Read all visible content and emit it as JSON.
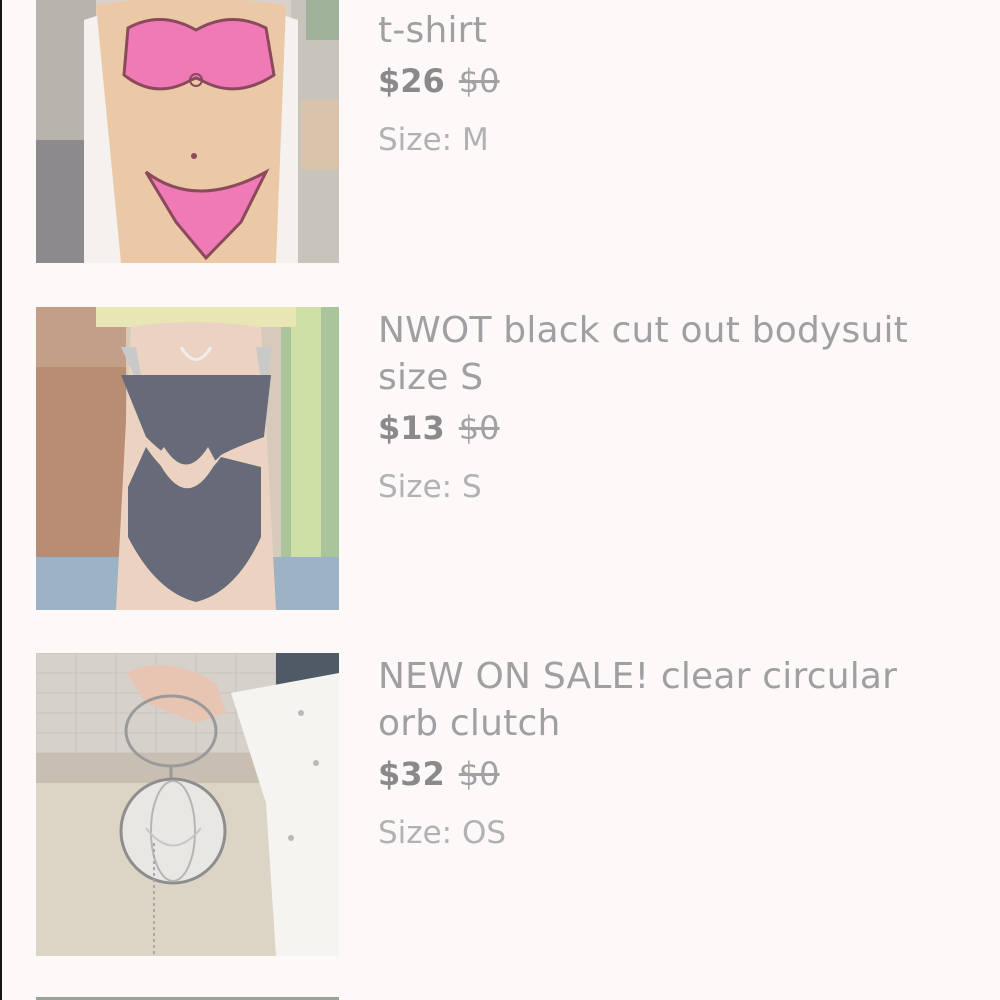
{
  "listings": [
    {
      "title_lines": [
        "t-shirt"
      ],
      "price": "$26",
      "original_price": "$0",
      "size_label": "Size:",
      "size_value": "M",
      "image_icon": "bikini-print-tshirt-photo"
    },
    {
      "title_lines": [
        "NWOT black cut out bodysuit",
        "size S"
      ],
      "price": "$13",
      "original_price": "$0",
      "size_label": "Size:",
      "size_value": "S",
      "image_icon": "black-bodysuit-photo"
    },
    {
      "title_lines": [
        "NEW ON SALE! clear circular",
        "orb clutch"
      ],
      "price": "$32",
      "original_price": "$0",
      "size_label": "Size:",
      "size_value": "OS",
      "image_icon": "clear-orb-clutch-photo"
    }
  ]
}
